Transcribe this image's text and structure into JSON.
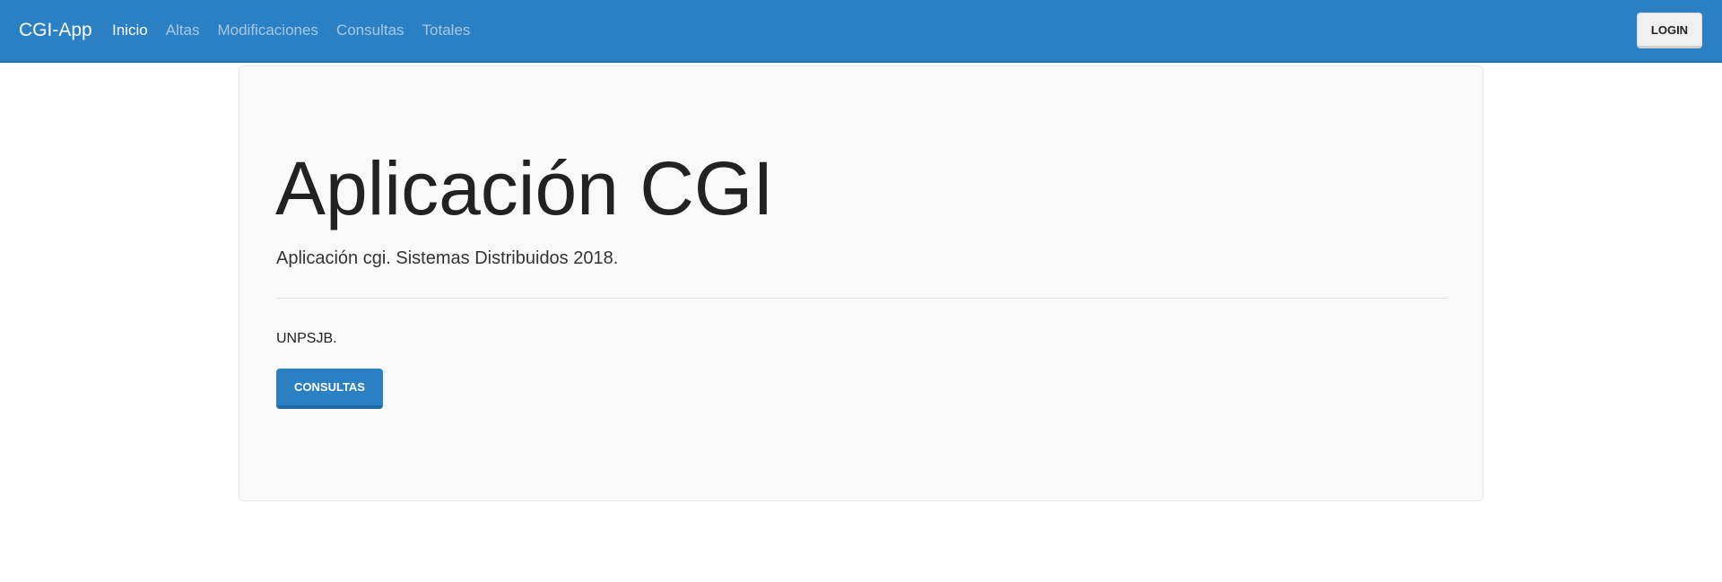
{
  "navbar": {
    "brand": "CGI-App",
    "items": [
      {
        "label": "Inicio",
        "active": true
      },
      {
        "label": "Altas",
        "active": false
      },
      {
        "label": "Modificaciones",
        "active": false
      },
      {
        "label": "Consultas",
        "active": false
      },
      {
        "label": "Totales",
        "active": false
      }
    ],
    "login_label": "LOGIN"
  },
  "jumbotron": {
    "title": "Aplicación CGI",
    "lead": "Aplicación cgi. Sistemas Distribuidos 2018.",
    "text": "UNPSJB.",
    "button_label": "CONSULTAS"
  },
  "colors": {
    "navbar_bg": "#2b80c3",
    "nav_inactive": "#a6c8e6",
    "jumbotron_bg": "#f9f9f9",
    "primary_button": "#2b80c3"
  }
}
